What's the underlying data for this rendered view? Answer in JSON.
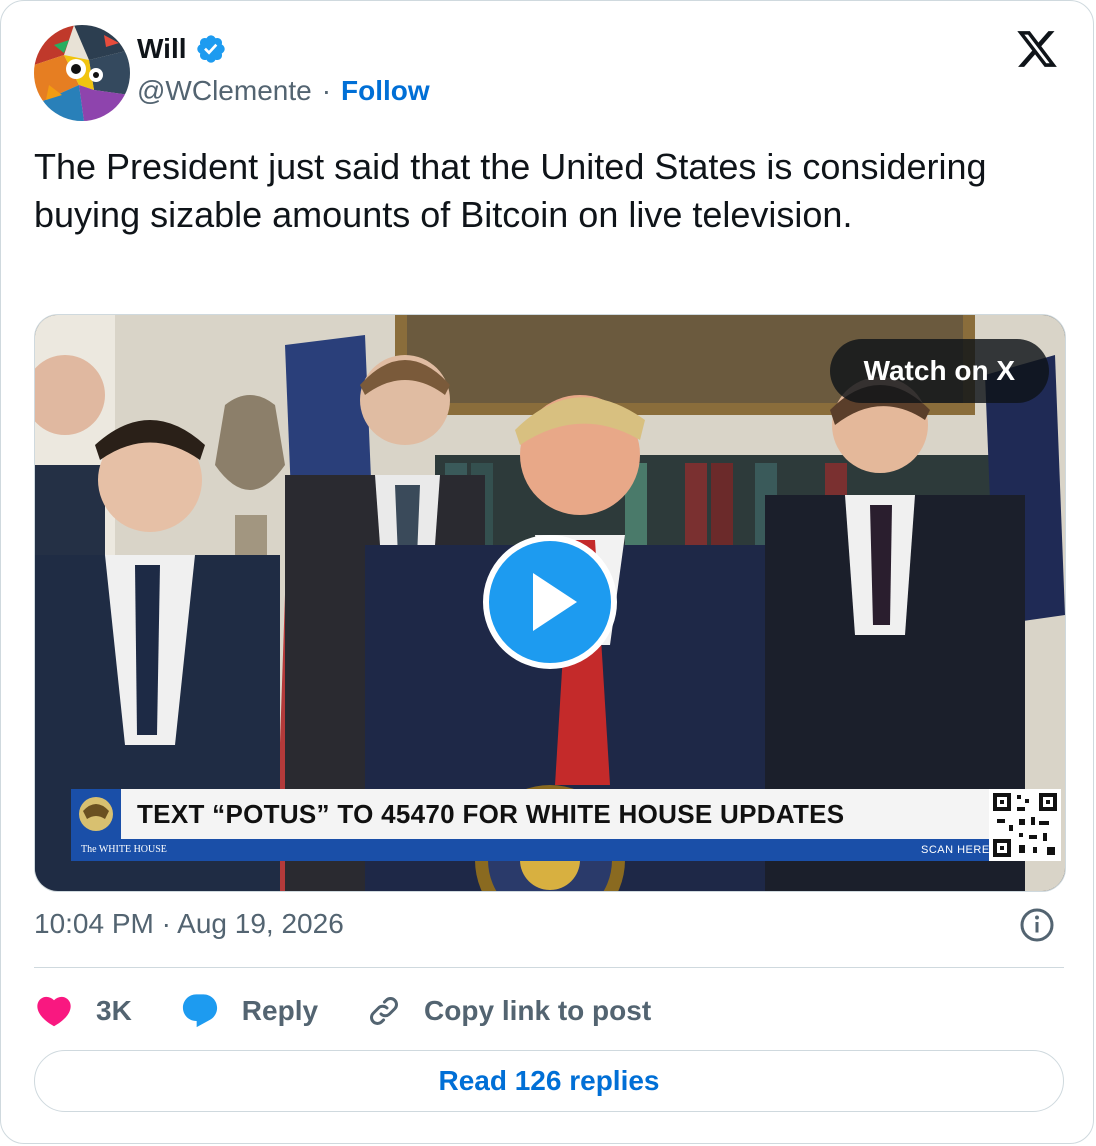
{
  "author": {
    "name": "Will",
    "handle": "@WClemente",
    "separator": "·",
    "follow_label": "Follow",
    "verified": true,
    "verified_color": "#1d9bf0"
  },
  "tweet": {
    "text": "The President just said that the United States is considering buying sizable amounts of Bitcoin on live television."
  },
  "media": {
    "watch_label": "Watch on X",
    "play_icon": "play-icon",
    "banner": {
      "headline": "TEXT “POTUS” TO 45470 FOR WHITE HOUSE UPDATES",
      "source": "The WHITE HOUSE",
      "scan_label": "SCAN HERE"
    }
  },
  "meta": {
    "timestamp": "10:04 PM · Aug 19, 2026"
  },
  "actions": {
    "like_count": "3K",
    "reply_label": "Reply",
    "copy_label": "Copy link to post",
    "like_color": "#f91880",
    "reply_color": "#1d9bf0"
  },
  "footer": {
    "read_replies_label": "Read 126 replies"
  },
  "colors": {
    "link": "#006fd6",
    "secondary_text": "#536471",
    "border": "#cfd9de"
  }
}
